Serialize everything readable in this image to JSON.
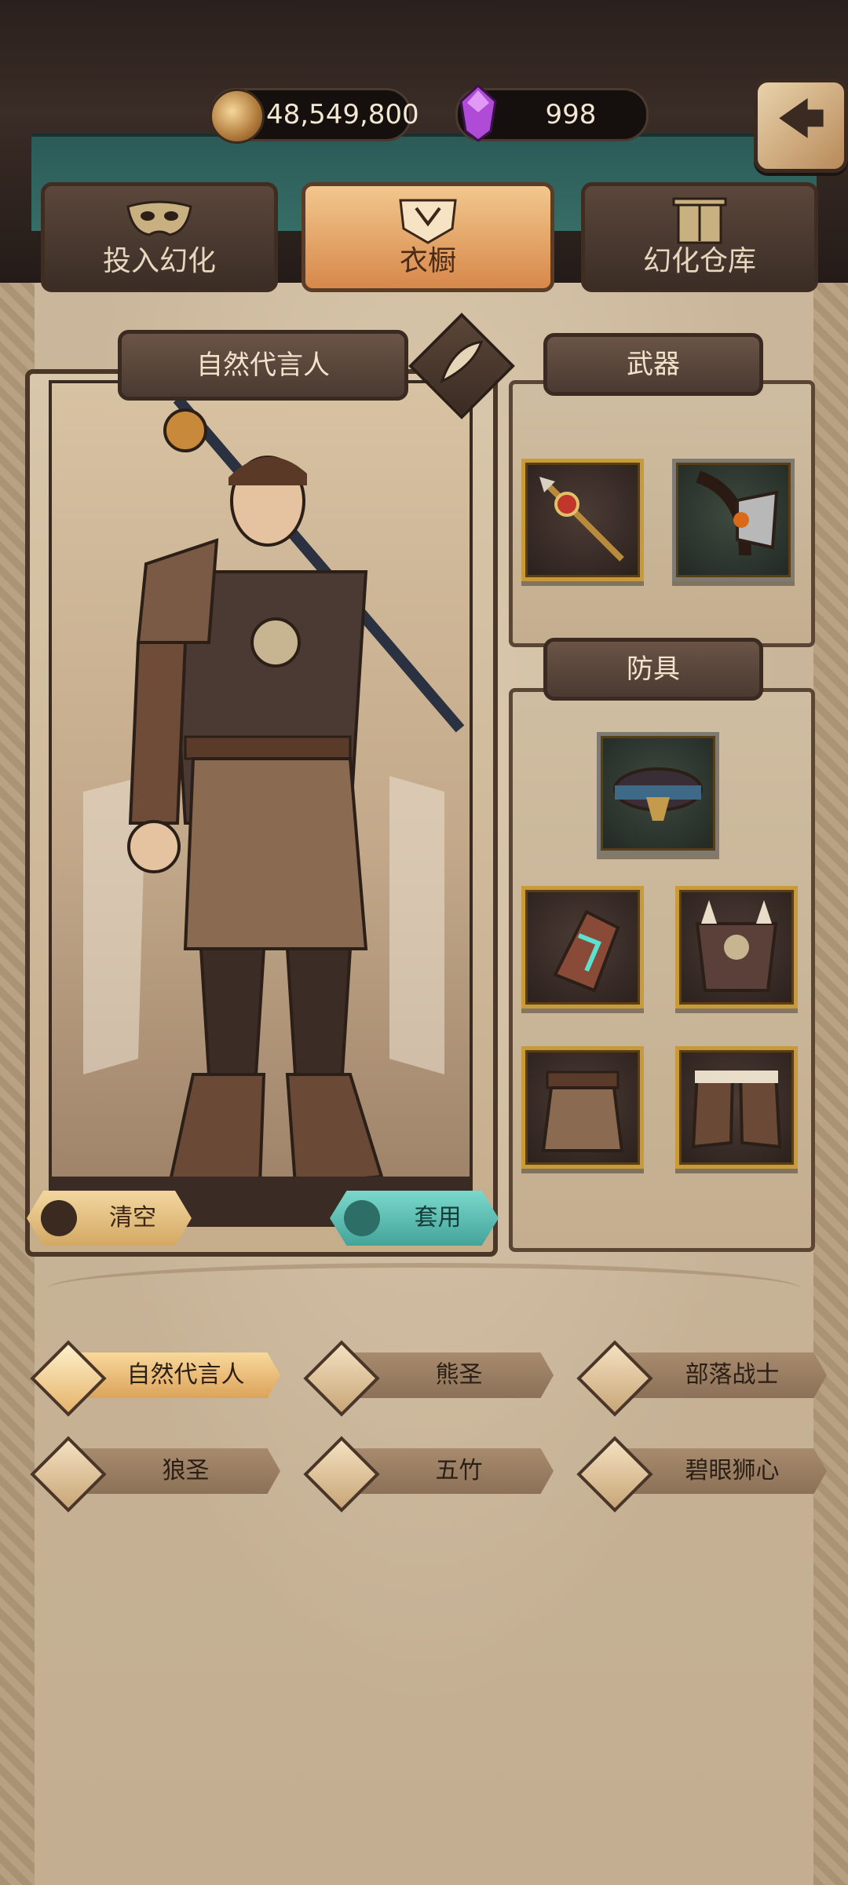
{
  "currency": {
    "gold": "48,549,800",
    "gems": "998"
  },
  "tabs": [
    {
      "label": "投入幻化",
      "icon": "mask-icon",
      "active": false
    },
    {
      "label": "衣橱",
      "icon": "wardrobe-crest-icon",
      "active": true
    },
    {
      "label": "幻化仓库",
      "icon": "cabinet-icon",
      "active": false
    }
  ],
  "character": {
    "name": "自然代言人"
  },
  "buttons": {
    "clear": "清空",
    "apply": "套用"
  },
  "sections": {
    "weapons": "武器",
    "armor": "防具"
  },
  "weapons": [
    {
      "icon": "staff-icon"
    },
    {
      "icon": "axe-icon"
    }
  ],
  "armor": [
    {
      "icon": "belt-icon"
    },
    {
      "icon": "bracer-icon"
    },
    {
      "icon": "chest-armor-icon"
    },
    {
      "icon": "kilt-icon"
    },
    {
      "icon": "boots-icon"
    }
  ],
  "outfits": [
    {
      "name": "自然代言人",
      "selected": true
    },
    {
      "name": "熊圣",
      "selected": false
    },
    {
      "name": "部落战士",
      "selected": false
    },
    {
      "name": "狼圣",
      "selected": false
    },
    {
      "name": "五竹",
      "selected": false
    },
    {
      "name": "碧眼狮心",
      "selected": false
    }
  ],
  "colors": {
    "accent_gold": "#dca45a",
    "accent_teal": "#44a49a",
    "panel_dark": "#4a3a31"
  }
}
